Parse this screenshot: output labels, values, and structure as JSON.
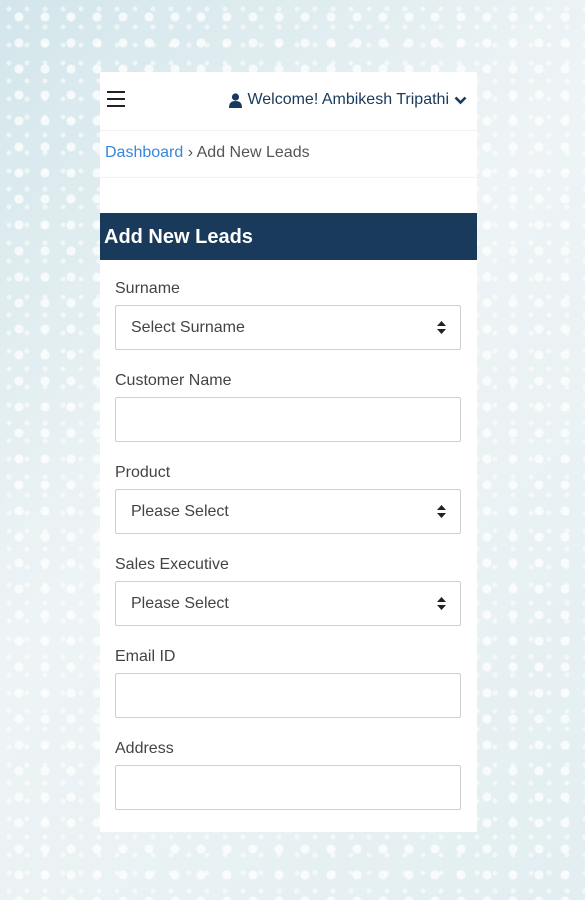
{
  "header": {
    "menu_icon": "hamburger-menu-icon",
    "user_icon": "user-icon",
    "welcome_text": "Welcome! Ambikesh Tripathi",
    "dropdown_icon": "chevron-down-icon"
  },
  "breadcrumb": {
    "home": "Dashboard",
    "separator": "›",
    "current": "Add New Leads"
  },
  "form": {
    "title": "Add New Leads",
    "fields": [
      {
        "label": "Surname",
        "type": "select",
        "value": "Select Surname"
      },
      {
        "label": "Customer Name",
        "type": "input",
        "value": ""
      },
      {
        "label": "Product",
        "type": "select",
        "value": "Please Select"
      },
      {
        "label": "Sales Executive",
        "type": "select",
        "value": "Please Select"
      },
      {
        "label": "Email ID",
        "type": "input",
        "value": ""
      },
      {
        "label": "Address",
        "type": "input",
        "value": ""
      }
    ]
  },
  "colors": {
    "header_bg": "#1a3a5c",
    "link": "#3a86d8",
    "welcome_text": "#1a3a5c"
  }
}
